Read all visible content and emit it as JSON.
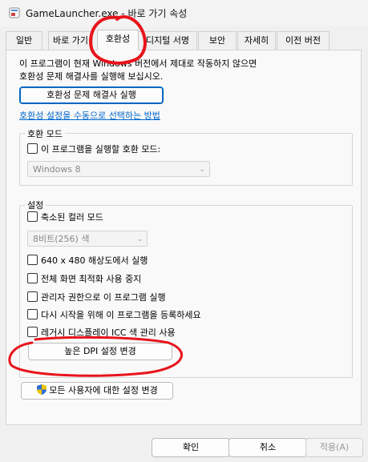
{
  "window": {
    "title": "GameLauncher.exe - 바로 가기 속성"
  },
  "tabs": [
    "일반",
    "바로 가기",
    "호환성",
    "디지털 서명",
    "보안",
    "자세히",
    "이전 버전"
  ],
  "compat": {
    "intro_line1": "이 프로그램이 현재 Windows 버전에서 제대로 작동하지 않으면",
    "intro_line2": "호환성 문제 해결사를 실행해 보십시오.",
    "troubleshooter_button": "호환성 문제 해결사 실행",
    "manual_link": "호환성 설정을 수동으로 선택하는 방법",
    "mode_group": {
      "title": "호환 모드",
      "checkbox": "이 프로그램을 실행할 호환 모드:",
      "checked": false,
      "select_value": "Windows 8"
    },
    "settings_group": {
      "title": "설정",
      "reduced_color": "축소된 컬러 모드",
      "color_select_value": "8비트(256) 색",
      "res_640": "640 x 480 해상도에서 실행",
      "disable_fullscreen": "전체 화면 최적화 사용 중지",
      "run_as_admin": "관리자 권한으로 이 프로그램 실행",
      "register_restart": "다시 시작을 위해 이 프로그램을 등록하세요",
      "legacy_icc": "레거시 디스플레이 ICC 색 관리 사용",
      "high_dpi_button": "높은 DPI 설정 변경"
    },
    "all_users_button": "모든 사용자에 대한 설정 변경"
  },
  "footer": {
    "ok": "확인",
    "cancel": "취소",
    "apply": "적용(A)"
  },
  "annotation_color": "#e8141c"
}
